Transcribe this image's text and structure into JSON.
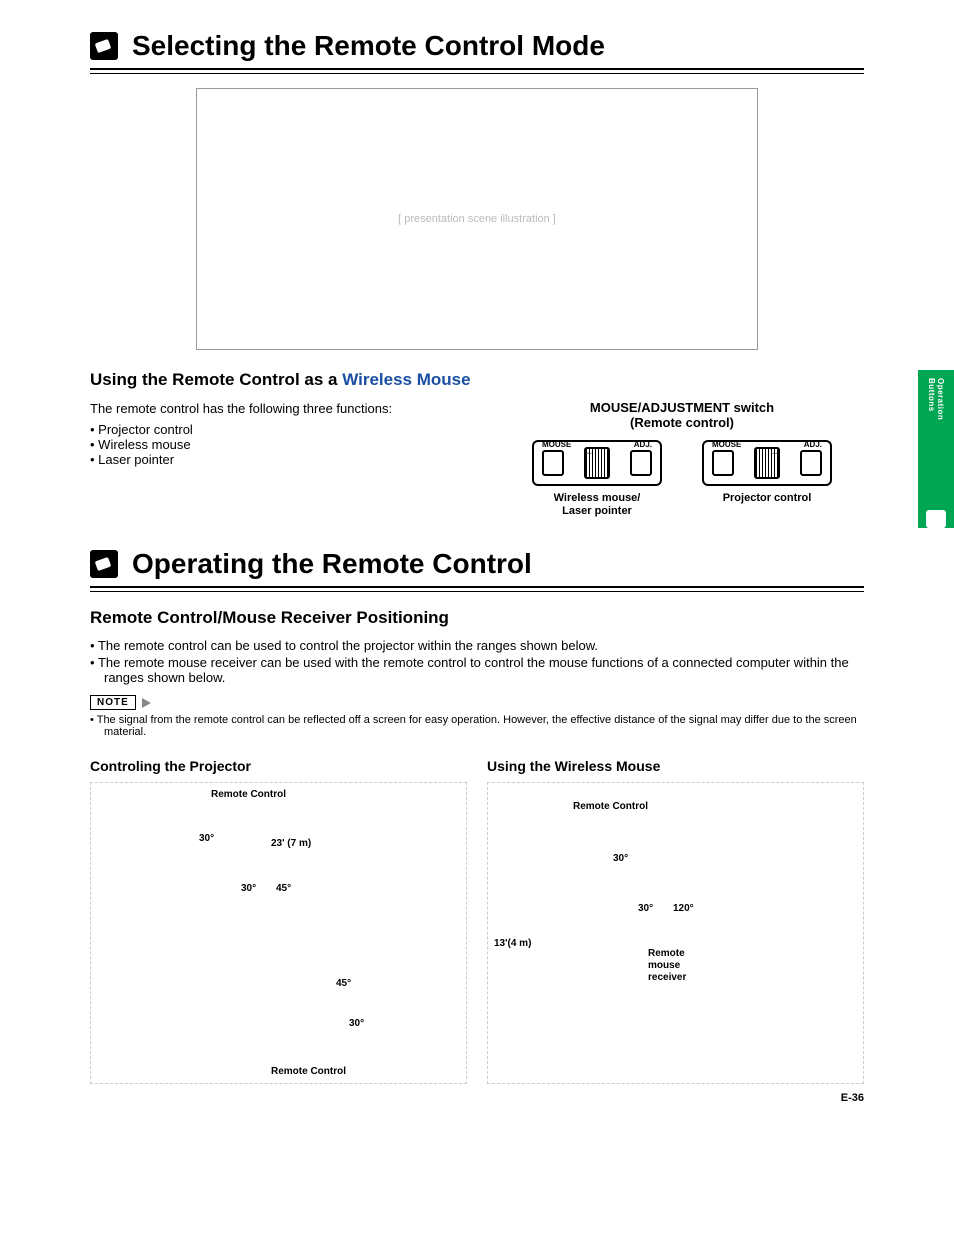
{
  "sideTab": {
    "label": "Operation Buttons"
  },
  "section1": {
    "title": "Selecting the Remote Control Mode",
    "subheading_prefix": "Using the Remote Control as a ",
    "subheading_link": "Wireless Mouse",
    "intro": "The remote control has the following three functions:",
    "functions": [
      "Projector control",
      "Wireless mouse",
      "Laser pointer"
    ],
    "switchHeading1": "MOUSE/ADJUSTMENT switch",
    "switchHeading2": "(Remote control)",
    "switchLabels": {
      "mouse": "MOUSE",
      "adj": "ADJ."
    },
    "switchCaptions": {
      "left1": "Wireless mouse/",
      "left2": "Laser pointer",
      "right": "Projector control"
    }
  },
  "section2": {
    "title": "Operating the Remote Control",
    "subheading": "Remote Control/Mouse Receiver Positioning",
    "bullets": [
      "The remote control can be used to control the projector within the ranges shown below.",
      "The remote mouse receiver can be used with the remote control to control the mouse functions of a connected computer within the ranges shown below."
    ],
    "noteLabel": "NOTE",
    "noteText": "The signal from the remote control can be reflected off a screen for easy operation. However, the effective distance of the signal may differ due to the screen material.",
    "diagramLeft": {
      "title": "Controling the Projector",
      "labels": {
        "remoteTop": "Remote Control",
        "remoteBottom": "Remote Control",
        "dist": "23' (7 m)",
        "a30": "30°",
        "a45": "45°"
      }
    },
    "diagramRight": {
      "title": "Using the Wireless Mouse",
      "labels": {
        "remote": "Remote Control",
        "receiver1": "Remote",
        "receiver2": "mouse",
        "receiver3": "receiver",
        "dist": "13'(4 m)",
        "a30": "30°",
        "a120": "120°"
      }
    }
  },
  "pageNumber": "E-36"
}
